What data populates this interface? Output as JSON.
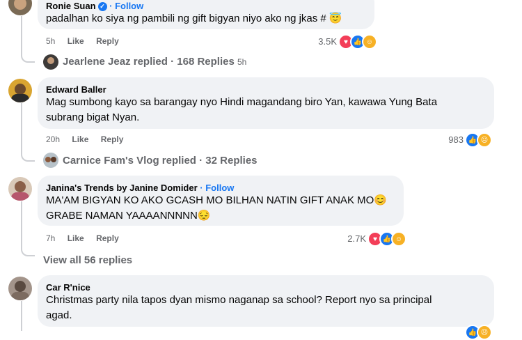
{
  "comments": [
    {
      "author": "Ronie Suan",
      "follow": "· Follow",
      "text_lines": [
        "padalhan ko siya ng pambili ng gift bigyan niyo ako ng jkas # 😇"
      ],
      "time": "5h",
      "like": "Like",
      "reply": "Reply",
      "reaction_count": "3.5K",
      "replied_by": "Jearlene Jeaz replied",
      "replies": "· 168 Replies",
      "replies_time": "5h"
    },
    {
      "author": "Edward Baller",
      "text_lines": [
        "Mag sumbong kayo sa barangay nyo Hindi magandang biro Yan, kawawa Yung Bata",
        "subrang bigat Nyan."
      ],
      "time": "20h",
      "like": "Like",
      "reply": "Reply",
      "reaction_count": "983",
      "replied_by": "Carnice Fam's Vlog replied",
      "replies": "· 32 Replies"
    },
    {
      "author": "Janina's Trends by Janine Domider",
      "follow": "· Follow",
      "text_lines": [
        "MA'AM BIGYAN KO AKO GCASH MO BILHAN NATIN GIFT ANAK MO😊",
        "GRABE NAMAN YAAAANNNNN😔"
      ],
      "time": "7h",
      "like": "Like",
      "reply": "Reply",
      "reaction_count": "2.7K",
      "view_all": "View all 56 replies"
    },
    {
      "author": "Car R'nice",
      "text_lines": [
        "Christmas party nila tapos dyan mismo naganap sa school? Report nyo sa principal",
        "agad."
      ]
    }
  ],
  "colors": {
    "bubble": "#f0f2f5",
    "link": "#1877f2",
    "meta": "#65676b"
  }
}
